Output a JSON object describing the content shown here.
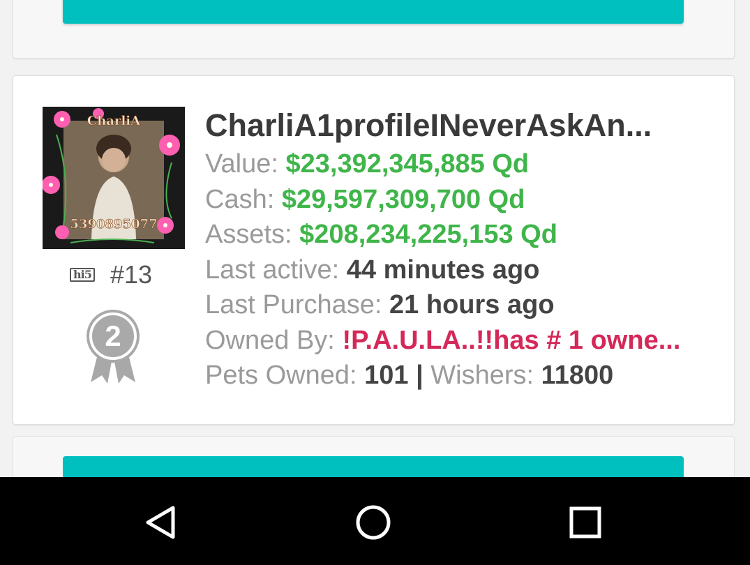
{
  "profile": {
    "name": "CharliA1profileINeverAskAn...",
    "avatar_caption_top": "CharliA",
    "avatar_caption_bottom": "5390895077",
    "rank": "#13",
    "network_logo": "hi5",
    "badge_number": "2"
  },
  "stats": {
    "value_label": "Value:",
    "value": "$23,392,345,885 Qd",
    "cash_label": "Cash:",
    "cash": "$29,597,309,700 Qd",
    "assets_label": "Assets:",
    "assets": "$208,234,225,153 Qd",
    "last_active_label": "Last active:",
    "last_active": "44 minutes ago",
    "last_purchase_label": "Last Purchase:",
    "last_purchase": "21 hours ago",
    "owned_by_label": "Owned By:",
    "owned_by": "!P.A.U.LA..!!has # 1 owne...",
    "pets_owned_label": "Pets Owned:",
    "pets_owned": "101",
    "separator": "|",
    "wishers_label": "Wishers:",
    "wishers": "11800"
  },
  "navbar": {
    "icons": [
      "back-icon",
      "home-icon",
      "recents-icon"
    ]
  },
  "colors": {
    "accent_teal": "#00bfbf",
    "money_green": "#3fb54a",
    "owner_pink": "#d42858"
  }
}
